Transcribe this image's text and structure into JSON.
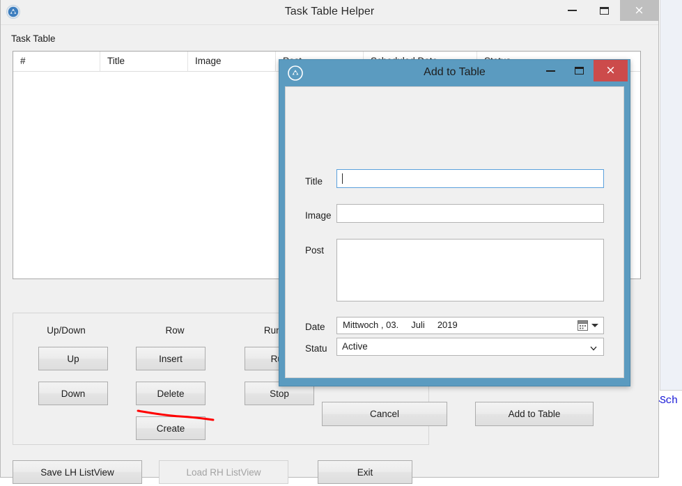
{
  "main_window": {
    "title": "Task Table Helper",
    "app_icon": "app-circle-triangle-icon",
    "controls": {
      "minimize": "minimize-icon",
      "maximize": "maximize-icon",
      "close": "×"
    },
    "section_label": "Task Table",
    "table": {
      "columns": [
        "#",
        "Title",
        "Image",
        "Post",
        "Scheduled Date",
        "Status"
      ],
      "rows": []
    },
    "groups": [
      {
        "heading": "Up/Down",
        "buttons": [
          "Up",
          "Down"
        ]
      },
      {
        "heading": "Row",
        "buttons": [
          "Insert",
          "Delete",
          "Create"
        ]
      },
      {
        "heading": "Run/Stop",
        "buttons": [
          "Run",
          "Stop"
        ]
      }
    ],
    "bottom_buttons": [
      {
        "label": "Save LH ListView",
        "enabled": true
      },
      {
        "label": "Load RH ListView",
        "enabled": false
      },
      {
        "label": "Exit",
        "enabled": true
      }
    ]
  },
  "dialog": {
    "title": "Add to Table",
    "app_icon": "app-circle-triangle-icon",
    "controls": {
      "minimize": "minimize-icon",
      "maximize": "maximize-icon",
      "close": "×"
    },
    "fields": {
      "title": {
        "label": "Title",
        "value": "",
        "placeholder": "",
        "focused": true
      },
      "image": {
        "label": "Image",
        "value": "",
        "placeholder": ""
      },
      "post": {
        "label": "Post",
        "value": "",
        "placeholder": ""
      },
      "date": {
        "label": "Date",
        "value": "Mittwoch , 03.     Juli     2019"
      },
      "status": {
        "label": "Statu",
        "value": "Active",
        "options": [
          "Active"
        ]
      }
    },
    "buttons": {
      "cancel": "Cancel",
      "submit": "Add to Table"
    }
  },
  "background": {
    "code_fragment": "Sch"
  },
  "colors": {
    "dialog_accent": "#5b9bc0",
    "dialog_close": "#cc4b4b",
    "focus_border": "#5aa0dc",
    "annotation": "#ff0000",
    "window_chrome": "#f0f0f0"
  }
}
